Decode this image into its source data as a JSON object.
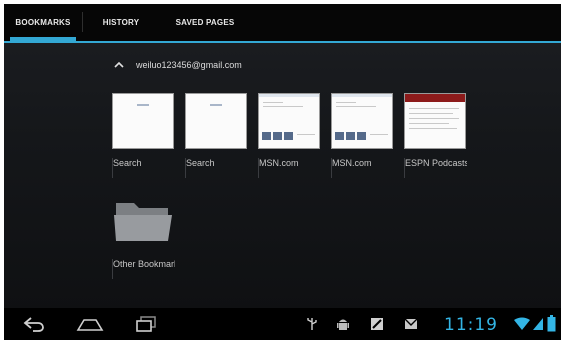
{
  "tabs": [
    {
      "label": "BOOKMARKS",
      "active": true
    },
    {
      "label": "HISTORY",
      "active": false
    },
    {
      "label": "SAVED PAGES",
      "active": false
    }
  ],
  "account": {
    "email": "weiluo123456@gmail.com"
  },
  "bookmarks": [
    {
      "label": "Search",
      "thumbnail": "blank-page"
    },
    {
      "label": "Search",
      "thumbnail": "blank-page"
    },
    {
      "label": "MSN.com",
      "thumbnail": "msn-page"
    },
    {
      "label": "MSN.com",
      "thumbnail": "msn-page"
    },
    {
      "label": "ESPN Podcasts",
      "thumbnail": "espn-page"
    }
  ],
  "folders": [
    {
      "label": "Other Bookmarks",
      "icon": "folder-icon"
    }
  ],
  "system_bar": {
    "nav_buttons": [
      "back-icon",
      "home-icon",
      "recent-apps-icon"
    ],
    "notifications": [
      "usb-icon",
      "android-debug-icon",
      "sd-card-icon",
      "email-icon"
    ],
    "time": "11:19",
    "status_icons": [
      "wifi-icon",
      "signal-icon",
      "battery-icon"
    ],
    "accent_color": "#33b5e5"
  }
}
